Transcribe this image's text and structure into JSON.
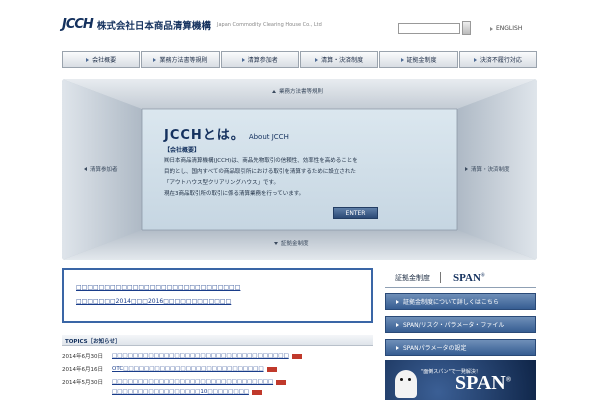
{
  "header": {
    "logo_mark": "JCCH",
    "logo_jp": "株式会社日本商品清算機構",
    "logo_en": "Japan Commodity Clearing House Co., Ltd",
    "search_placeholder": "",
    "lang_label": "ENGLISH"
  },
  "nav": {
    "items": [
      {
        "label": "会社概要"
      },
      {
        "label": "業務方法書等規則"
      },
      {
        "label": "清算参加者"
      },
      {
        "label": "清算・決済制度"
      },
      {
        "label": "証拠金制度"
      },
      {
        "label": "決済不履行対応"
      }
    ]
  },
  "hero": {
    "top_label": "業務方法書等規則",
    "bottom_label": "証拠金制度",
    "left_label": "清算参加者",
    "right_label": "清算・決済制度",
    "title_jp": "JCCHとは。",
    "title_en": "About JCCH",
    "section_label": "【会社概要】",
    "body_lines": [
      "㈱日本商品清算機構(JCCH)は、商品先物取引の信頼性、効率性を高めることを",
      "目的とし、国内すべての商品取引所における取引を清算するために設立された",
      "「アウトハウス型クリアリングハウス」です。",
      "現在3商品取引所の取引に係る清算業務を行っています。"
    ],
    "enter_label": "ENTER"
  },
  "notice": {
    "link1": "□□□□□□□□□□□□□□□□□□□□□□□□□□□□□",
    "link2": "□□□□□□□2014□□□2016□□□□□□□□□□□□"
  },
  "topics": {
    "heading": "TOPICS［お知らせ］",
    "items": [
      {
        "date": "2014年6月30日",
        "text": "□□□□□□□□□□□□□□□□□□□□□□□□□□□□□□□□□□",
        "new": true
      },
      {
        "date": "2014年6月16日",
        "text": "OTC□□□□□□□□□□□□□□□□□□□□□□□□□□□",
        "new": true
      },
      {
        "date": "2014年5月30日",
        "text": "□□□□□□□□□□□□□□□□□□□□□□□□□□□□□□□",
        "new": true
      },
      {
        "date": "",
        "text": "□□□□□□□□□□□□□□□□□10□□□□□□□□",
        "new": true
      }
    ]
  },
  "side": {
    "head_label": "証拠金制度",
    "head_logo": "SPAN",
    "buttons": [
      {
        "label": "証拠金制度について詳しくはこちら"
      },
      {
        "label": "SPAN/リスク・パラメータ・ファイル"
      },
      {
        "label": "SPANパラメータの設定"
      }
    ],
    "banner_caption": "\"面倒スパン\"で一発解決！",
    "banner_logo": "SPAN"
  }
}
